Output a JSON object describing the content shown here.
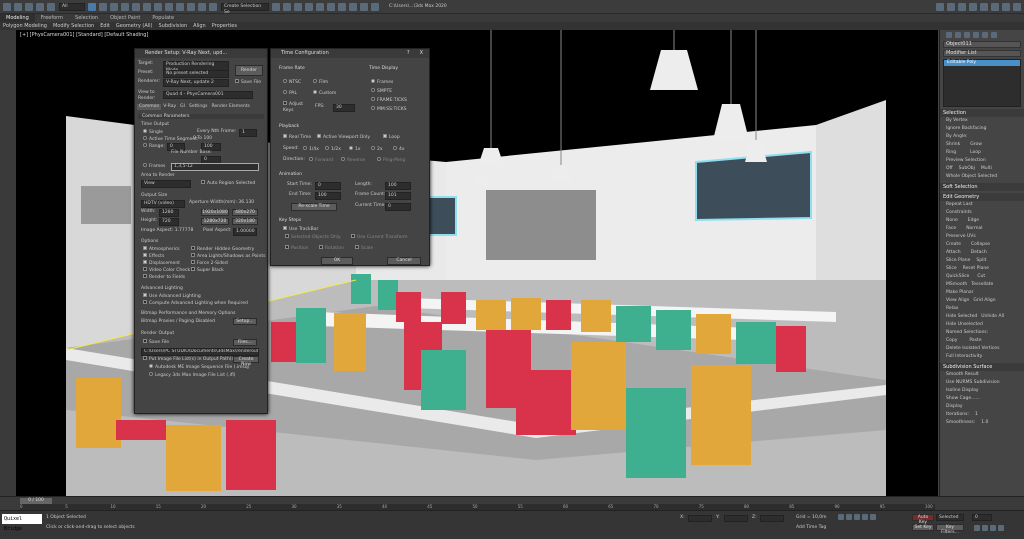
{
  "app": {
    "title": "C:\\Users\\...\\3ds Max 2020"
  },
  "toolbar": {
    "selection_filter": "All",
    "select_by": "Create Selection Se"
  },
  "ribbon": {
    "tabs": [
      "Modeling",
      "Freeform",
      "Selection",
      "Object Paint",
      "Populate"
    ],
    "sub": [
      "Polygon Modeling",
      "Modify Selection",
      "Edit",
      "Geometry (All)",
      "Subdivision",
      "Align",
      "Properties"
    ]
  },
  "viewport": {
    "label": "[+] [PhysCamera001] [Standard] [Default Shading]"
  },
  "render_setup": {
    "title": "Render Setup: V-Ray Next, upd...",
    "target_label": "Target:",
    "target_value": "Production Rendering Mode",
    "preset_label": "Preset:",
    "preset_value": "No preset selected",
    "renderer_label": "Renderer:",
    "renderer_value": "V-Ray Next, update 2",
    "view_label": "View to Render:",
    "view_value": "Quad 4 - PhysCamera001",
    "render_btn": "Render",
    "save_file": "Save File",
    "tabs": [
      "Common",
      "V-Ray",
      "GI",
      "Settings",
      "Render Elements"
    ],
    "section": "Common Parameters",
    "time_output": "Time Output",
    "single": "Single",
    "every_nth": "Every Nth Frame:",
    "every_nth_val": "1",
    "active_segment": "Active Time Segment:",
    "active_range": "0 To 100",
    "range": "Range:",
    "range_from": "0",
    "range_to": "100",
    "file_number_base": "File Number Base:",
    "file_number_base_val": "0",
    "frames": "Frames",
    "frames_val": "1,3,5-12",
    "area_label": "Area to Render",
    "area_value": "View",
    "auto_region": "Auto Region Selected",
    "output_size": "Output Size",
    "output_preset": "HDTV (video)",
    "aperture": "Aperture Width(mm): 36.130",
    "width_label": "Width:",
    "width_val": "1280",
    "height_label": "Height:",
    "height_val": "720",
    "presets": [
      "1920x1080",
      "480x270",
      "1280x720",
      "320x180"
    ],
    "image_aspect": "Image Aspect: 1.77778",
    "pixel_aspect": "Pixel Aspect:",
    "pixel_aspect_val": "1.00000",
    "options": "Options",
    "opts": [
      "Atmospherics",
      "Render Hidden Geometry",
      "Effects",
      "Area Lights/Shadows as Points",
      "Displacement",
      "Force 2-Sided",
      "Video Color Check",
      "Super Black",
      "Render to Fields"
    ],
    "adv_lighting": "Advanced Lighting",
    "use_adv": "Use Advanced Lighting",
    "compute_adv": "Compute Advanced Lighting when Required",
    "bitmap_perf": "Bitmap Performance and Memory Options",
    "bitmap_proxies": "Bitmap Proxies / Paging Disabled",
    "setup_btn": "Setup...",
    "render_output": "Render Output",
    "save_file2": "Save File",
    "files_btn": "Files...",
    "output_path": "C:\\Users\\PC STUDIO\\Documents\\3dsMax\\renderoutput\\",
    "put_image": "Put Image File List(s) in Output Path(s)",
    "create_now": "Create Now",
    "autodesk_seq": "Autodesk ME Image Sequence File (.imsq)",
    "legacy_seq": "Legacy 3ds Max Image File List (.ifl)"
  },
  "time_config": {
    "title": "Time Configuration",
    "help": "?",
    "close": "X",
    "frame_rate": "Frame Rate",
    "ntsc": "NTSC",
    "film": "Film",
    "pal": "PAL",
    "custom": "Custom",
    "adjust_keys": "Adjust Keys",
    "fps_label": "FPS:",
    "fps_val": "30",
    "time_display": "Time Display",
    "frames": "Frames",
    "smpte": "SMPTE",
    "frame_ticks": "FRAME:TICKS",
    "mm_ss_ticks": "MM:SS:TICKS",
    "playback": "Playback",
    "real_time": "Real Time",
    "active_viewport": "Active Viewport Only",
    "loop": "Loop",
    "speed_label": "Speed:",
    "speeds": [
      "1/4x",
      "1/2x",
      "1x",
      "2x",
      "4x"
    ],
    "direction_label": "Direction:",
    "directions": [
      "Forward",
      "Reverse",
      "Ping-Pong"
    ],
    "animation": "Animation",
    "start_label": "Start Time:",
    "start_val": "0",
    "length_label": "Length:",
    "length_val": "100",
    "end_label": "End Time:",
    "end_val": "100",
    "frame_count_label": "Frame Count:",
    "frame_count_val": "101",
    "rescale": "Re-scale Time",
    "current_label": "Current Time:",
    "current_val": "0",
    "key_steps": "Key Steps",
    "use_trackbar": "Use TrackBar",
    "selected_only": "Selected Objects Only",
    "use_current": "Use Current Transform",
    "position": "Position",
    "rotation": "Rotation",
    "scale": "Scale",
    "ok": "OK",
    "cancel": "Cancel"
  },
  "command_panel": {
    "object_name": "Object011",
    "modifier_list": "Modifier List",
    "stack_item": "Editable Poly",
    "selection": "Selection",
    "by_vertex": "By Vertex",
    "ignore_backfacing": "Ignore Backfacing",
    "by_angle": "By Angle:",
    "shrink": "Shrink",
    "grow": "Grow",
    "ring": "Ring",
    "loop": "Loop",
    "preview_selection": "Preview Selection",
    "off": "Off",
    "subobj": "SubObj",
    "multi": "Multi",
    "whole_object": "Whole Object Selected",
    "soft_selection": "Soft Selection",
    "edit_geometry": "Edit Geometry",
    "repeat_last": "Repeat Last",
    "constraints": "Constraints",
    "none": "None",
    "edge": "Edge",
    "face": "Face",
    "normal": "Normal",
    "preserve_uvs": "Preserve UVs",
    "create": "Create",
    "collapse": "Collapse",
    "attach": "Attach",
    "detach": "Detach",
    "slice_plane": "Slice Plane",
    "split": "Split",
    "slice": "Slice",
    "reset_plane": "Reset Plane",
    "quickslice": "QuickSlice",
    "cut": "Cut",
    "msmooth": "MSmooth",
    "tessellate": "Tessellate",
    "make_planar": "Make Planar",
    "view_align": "View Align",
    "grid_align": "Grid Align",
    "relax": "Relax",
    "hide_selected": "Hide Selected",
    "unhide_all": "Unhide All",
    "hide_unselected": "Hide Unselected",
    "named_selections": "Named Selections:",
    "copy": "Copy",
    "paste": "Paste",
    "delete_isolated": "Delete Isolated Vertices",
    "full_interactivity": "Full Interactivity",
    "subdivision_surface": "Subdivision Surface",
    "smooth_result": "Smooth Result",
    "use_nurms": "Use NURMS Subdivision",
    "isoline": "Isoline Display",
    "show_cage": "Show Cage......",
    "display": "Display",
    "iterations": "Iterations:",
    "iterations_val": "1",
    "smoothness": "Smoothness:",
    "smoothness_val": "1.0"
  },
  "timeline": {
    "frame_counter": "0 / 100",
    "ticks": [
      "0",
      "5",
      "10",
      "15",
      "20",
      "25",
      "30",
      "35",
      "40",
      "45",
      "50",
      "55",
      "60",
      "65",
      "70",
      "75",
      "80",
      "85",
      "90",
      "95",
      "100"
    ]
  },
  "status": {
    "maxscript": "Quixel Bridge",
    "objects_selected": "1 Object Selected",
    "hint": "Click or click-and-drag to select objects",
    "x_label": "X:",
    "y_label": "Y:",
    "z_label": "Z:",
    "grid": "Grid = 10,0m",
    "add_time_tag": "Add Time Tag",
    "auto_key": "Auto Key",
    "set_key": "Set Key",
    "selected": "Selected",
    "key_filters": "Key Filters...",
    "frame": "0"
  },
  "colors": {
    "accent": "#4a90c8",
    "chair_red": "#d8334a",
    "chair_teal": "#3fb08f",
    "chair_yellow": "#e2a73a"
  }
}
